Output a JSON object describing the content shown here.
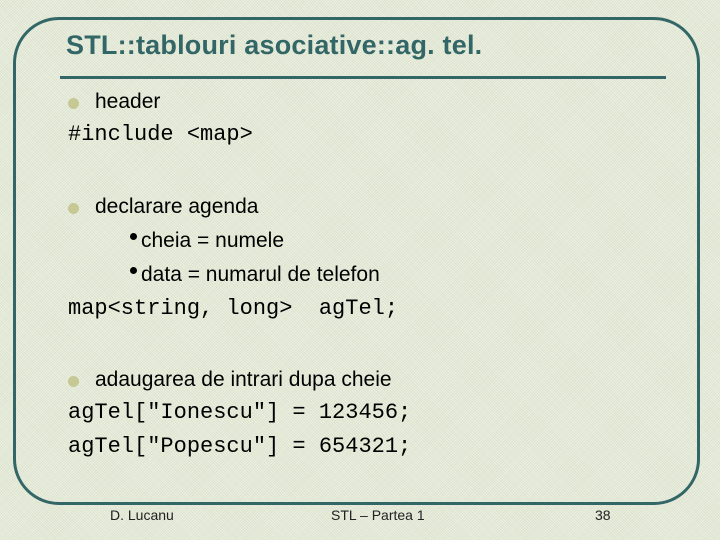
{
  "slide": {
    "title": "STL::tablouri asociative::ag. tel.",
    "sections": [
      {
        "bullet": "header",
        "code": [
          "#include <map>"
        ]
      },
      {
        "bullet": "declarare agenda",
        "subbullets": [
          "cheia = numele",
          "data = numarul de telefon"
        ],
        "code": [
          "map<string, long>  agTel;"
        ]
      },
      {
        "bullet": "adaugarea de intrari dupa cheie",
        "code": [
          "agTel[\"Ionescu\"] = 123456;",
          "agTel[\"Popescu\"] = 654321;"
        ]
      }
    ]
  },
  "footer": {
    "author": "D. Lucanu",
    "course": "STL – Partea 1",
    "page_number": "38"
  },
  "colors": {
    "accent": "#336666",
    "bullet": "#C6C993",
    "background": "#E4E9D6"
  }
}
